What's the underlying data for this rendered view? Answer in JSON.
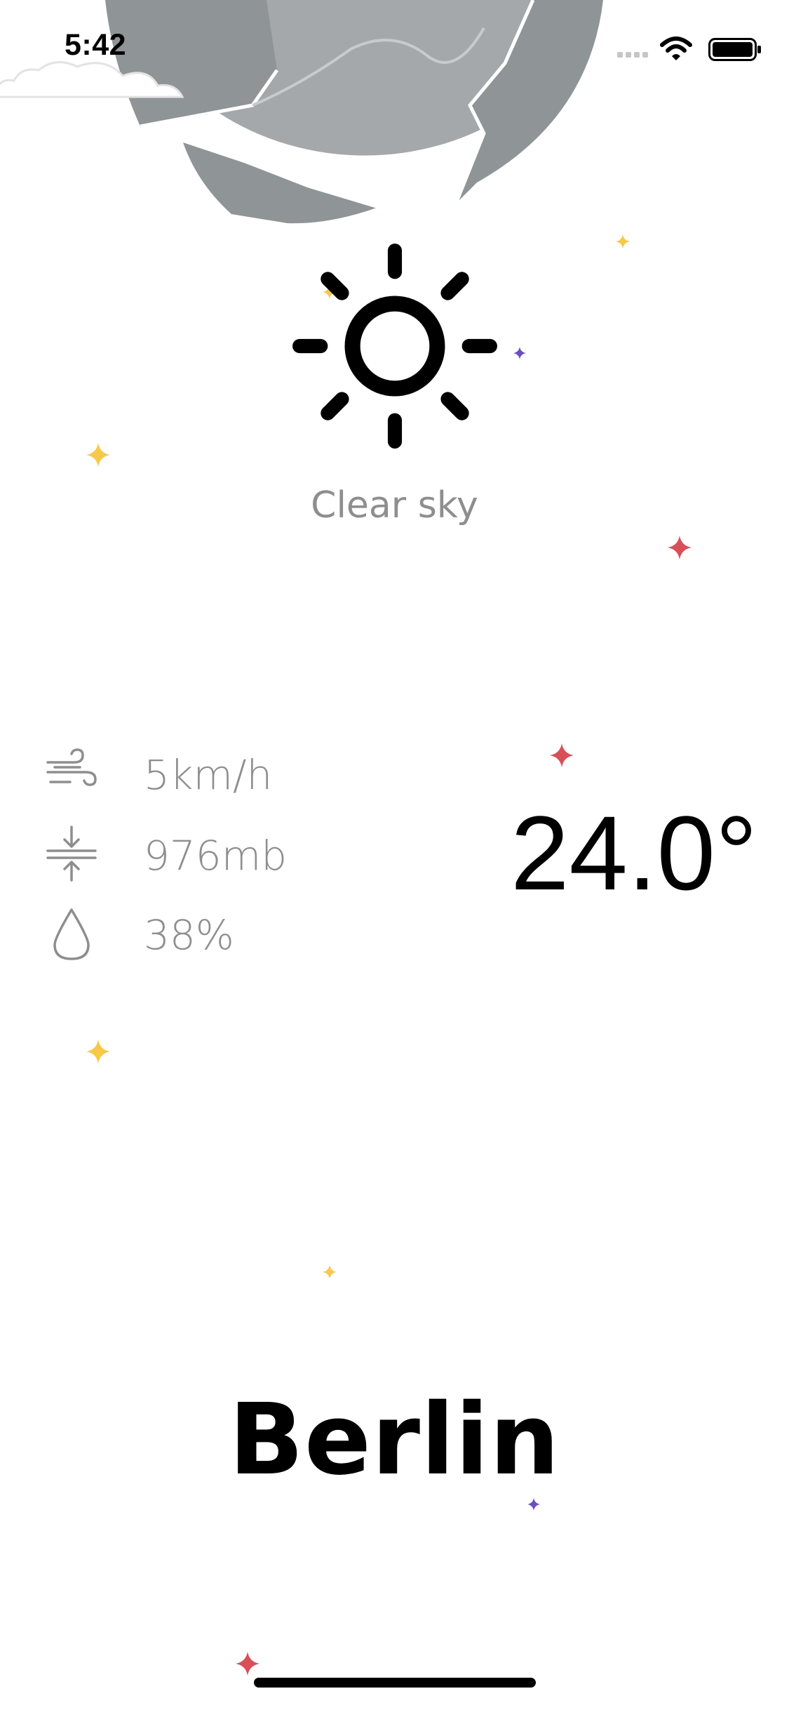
{
  "status_bar": {
    "time": "5:42",
    "icons": [
      "signal-icon",
      "wifi-icon",
      "battery-icon"
    ]
  },
  "weather": {
    "condition_icon": "sun-icon",
    "description": "Clear sky",
    "temperature": "24.0°",
    "city": "Berlin"
  },
  "stats": [
    {
      "icon": "wind-icon",
      "value": "5km/h"
    },
    {
      "icon": "pressure-icon",
      "value": "976mb"
    },
    {
      "icon": "humidity-drop-icon",
      "value": "38%"
    }
  ],
  "colors": {
    "moon_light": "#a4a8ab",
    "moon_dark": "#8e9396",
    "star_yellow": "#f6c94b",
    "star_red": "#d94f57",
    "star_purple": "#6b4fbf",
    "text_gray": "#8e8e8e"
  }
}
